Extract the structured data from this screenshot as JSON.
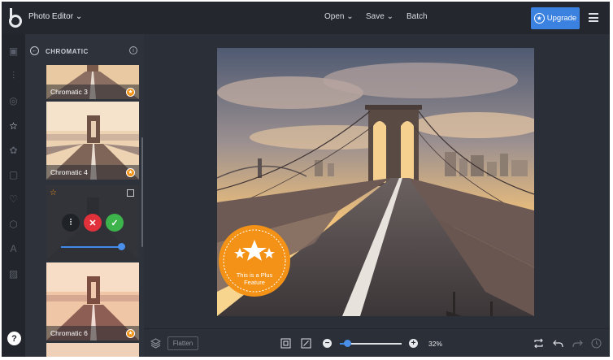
{
  "app": {
    "title": "Photo Editor ⌄",
    "menus": {
      "open": "Open ⌄",
      "save": "Save ⌄",
      "batch": "Batch"
    },
    "upgrade_label": "Upgrade",
    "colors": {
      "accent": "#3b82e0",
      "plus_orange": "#f29112",
      "cancel_red": "#e1313b",
      "apply_green": "#3cb44b"
    }
  },
  "rail": {
    "icons": [
      "image-icon",
      "adjust-icon",
      "effects-icon",
      "star-icon",
      "frame-icon",
      "border-icon",
      "heart-icon",
      "shape-icon",
      "text-icon",
      "texture-icon"
    ],
    "help_label": "?"
  },
  "panel": {
    "title": "CHROMATIC",
    "thumbs": [
      {
        "label": "Chromatic 3"
      },
      {
        "label": "Chromatic 4"
      },
      {
        "label": "Chromatic 6"
      }
    ],
    "intensity": 0.98
  },
  "canvas": {
    "plus_seal": {
      "line1": "This is a Plus",
      "line2": "Feature"
    }
  },
  "bottombar": {
    "flatten_label": "Flatten",
    "zoom_minus": "−",
    "zoom_plus": "+",
    "zoom_label": "32%",
    "zoom_fraction": 0.12
  }
}
